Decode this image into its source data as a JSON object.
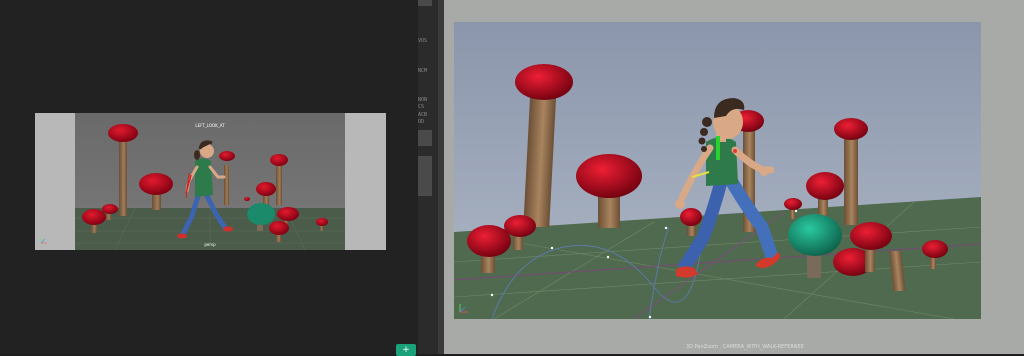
{
  "left_viewport": {
    "hud_top": "LEFT_LOOK_AT",
    "hud_bottom": "persp"
  },
  "divider": {
    "labels": [
      "VOS",
      "NCM",
      "NON",
      "CS",
      "ACB",
      "OD"
    ]
  },
  "right_viewport": {
    "status_text": "3D PanZoom : CAMERA_WITH_WALK-REFERNEE"
  },
  "colors": {
    "mushroom_cap": "#b5001a",
    "mushroom_stem": "#8a6a4a",
    "ground": "#4f6a4e",
    "sky": "#9aa6bc",
    "accent_green": "#1aa37a"
  },
  "icons": {
    "add_button": "plus-icon"
  }
}
